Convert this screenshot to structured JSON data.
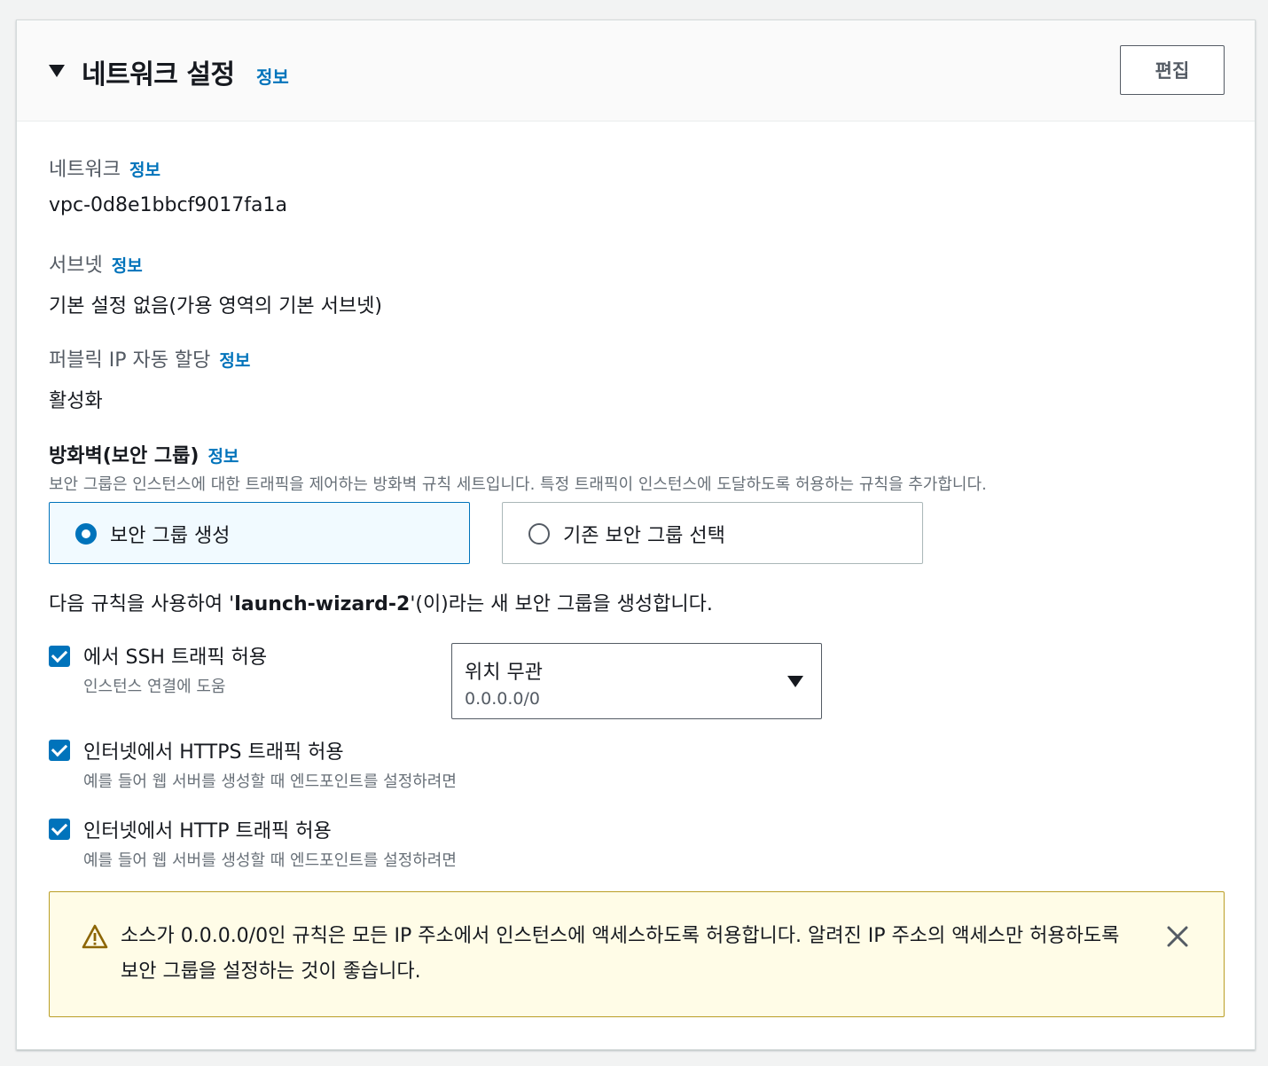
{
  "header": {
    "title": "네트워크 설정",
    "info": "정보",
    "edit_label": "편집"
  },
  "network": {
    "label": "네트워크",
    "info": "정보",
    "value": "vpc-0d8e1bbcf9017fa1a"
  },
  "subnet": {
    "label": "서브넷",
    "info": "정보",
    "value": "기본 설정 없음(가용 영역의 기본 서브넷)"
  },
  "public_ip": {
    "label": "퍼블릭 IP 자동 할당",
    "info": "정보",
    "value": "활성화"
  },
  "firewall": {
    "title": "방화벽(보안 그룹)",
    "info": "정보",
    "description": "보안 그룹은 인스턴스에 대한 트래픽을 제어하는 방화벽 규칙 세트입니다. 특정 트래픽이 인스턴스에 도달하도록 허용하는 규칙을 추가합니다.",
    "options": [
      {
        "label": "보안 그룹 생성",
        "selected": true
      },
      {
        "label": "기존 보안 그룹 선택",
        "selected": false
      }
    ],
    "create_prefix": "다음 규칙을 사용하여 '",
    "group_name": "launch-wizard-2",
    "create_suffix": "'(이)라는 새 보안 그룹을 생성합니다."
  },
  "rules": [
    {
      "label": "에서 SSH 트래픽 허용",
      "description": "인스턴스 연결에 도움",
      "checked": true
    },
    {
      "label": "인터넷에서 HTTPS 트래픽 허용",
      "description": "예를 들어 웹 서버를 생성할 때 엔드포인트를 설정하려면",
      "checked": true
    },
    {
      "label": "인터넷에서 HTTP 트래픽 허용",
      "description": "예를 들어 웹 서버를 생성할 때 엔드포인트를 설정하려면",
      "checked": true
    }
  ],
  "ssh_source": {
    "selected": "위치 무관",
    "sub": "0.0.0.0/0"
  },
  "warning": {
    "text": "소스가 0.0.0.0/0인 규칙은 모든 IP 주소에서 인스턴스에 액세스하도록 허용합니다. 알려진 IP 주소의 액세스만 허용하도록 보안 그룹을 설정하는 것이 좋습니다."
  },
  "colors": {
    "accent": "#0073bb",
    "warning_bg": "#fffce7",
    "warning_border": "#ba9e26",
    "warning_icon": "#8d6605"
  }
}
